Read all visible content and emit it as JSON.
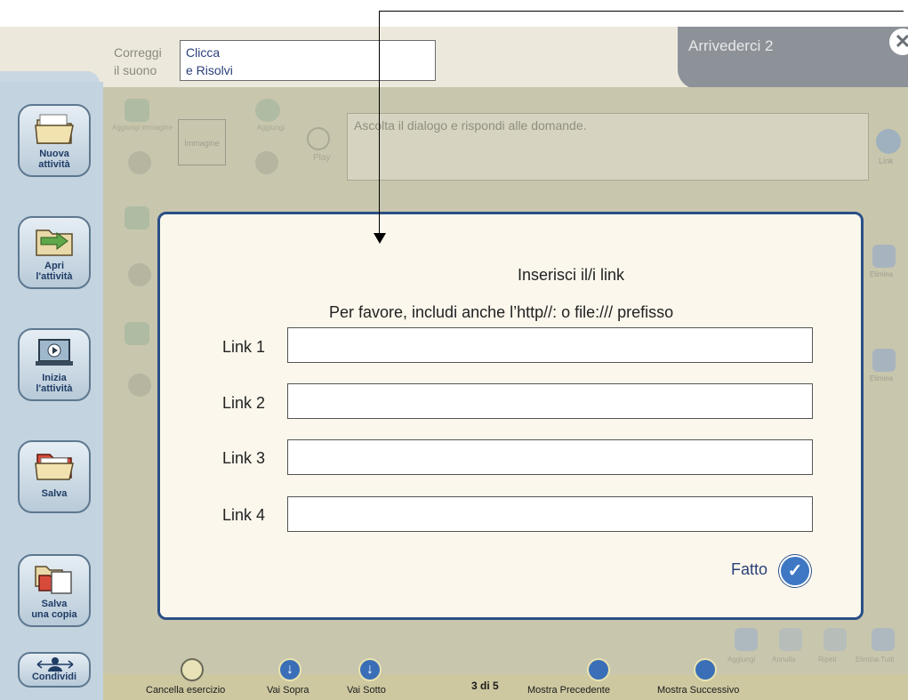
{
  "header": {
    "correggi_line1": "Correggi",
    "correggi_line2": "il suono",
    "answer_line1": "Clicca",
    "answer_line2": "e Risolvi",
    "title": "Arrivederci 2",
    "close_glyph": "✕"
  },
  "editor": {
    "instruction_text": "Ascolta il dialogo e rispondi alle domande.",
    "image_placeholder": "Immagine",
    "ghost_add_image": "Aggiungi immagine",
    "ghost_add": "Aggiungi",
    "ghost_play": "Play",
    "link_label": "Link",
    "elimina_label": "Elimina"
  },
  "sidebar": {
    "items": [
      {
        "label_line1": "Nuova",
        "label_line2": "attività"
      },
      {
        "label_line1": "Apri",
        "label_line2": "l'attività"
      },
      {
        "label_line1": "Inizia",
        "label_line2": "l'attività"
      },
      {
        "label_line1": "Salva",
        "label_line2": ""
      },
      {
        "label_line1": "Salva",
        "label_line2": "una copia"
      }
    ],
    "share_label": "Condividi"
  },
  "modal": {
    "title": "Inserisci il/i link",
    "subtitle": "Per favore, includi anche l’http//: o file:/// prefisso",
    "links": [
      {
        "label": "Link 1",
        "value": ""
      },
      {
        "label": "Link 2",
        "value": ""
      },
      {
        "label": "Link 3",
        "value": ""
      },
      {
        "label": "Link 4",
        "value": ""
      }
    ],
    "done_label": "Fatto",
    "done_glyph": "✓"
  },
  "toolbar": {
    "clear_exercise": "Cancella esercizio",
    "move_up": "Vai Sopra",
    "move_down": "Vai Sotto",
    "page_indicator": "3 di 5",
    "show_previous": "Mostra Precedente",
    "show_next": "Mostra Successivo",
    "add": "Aggiungi",
    "mini_2": "Annulla",
    "mini_3": "Ripeti",
    "delete_all": "Elimina Tutti",
    "arrow_glyph": "↓"
  },
  "colors": {
    "accent": "#2a4f86",
    "sidebar_bg": "#c3d3df",
    "title_tab": "#8d9299",
    "done_blue": "#3e78c4"
  }
}
